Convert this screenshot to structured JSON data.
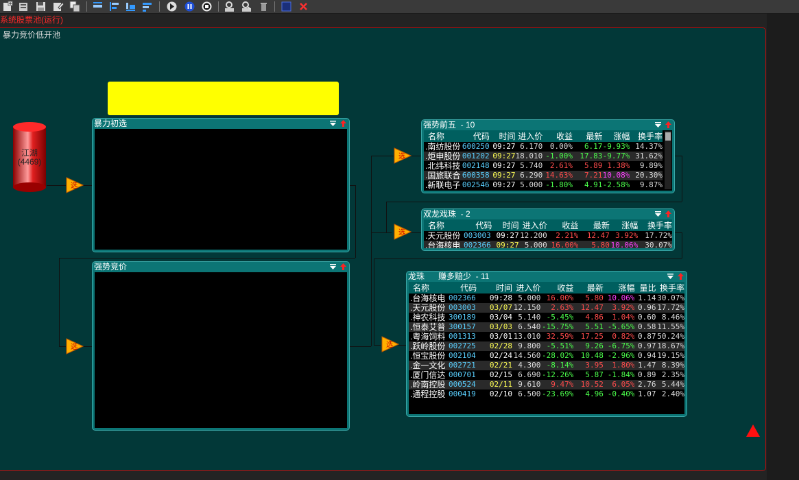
{
  "status_line": "系统股票池(运行)",
  "canvas_title": "暴力竞价低开池",
  "source": {
    "name": "江湖",
    "count": "(4469)"
  },
  "colors": {
    "up": "#ff4c4c",
    "down": "#4cff4c",
    "magenta": "#ff40ff",
    "code": "#5ad0ff"
  },
  "panels": {
    "violent": {
      "title": "暴力初选"
    },
    "strong": {
      "title": "强势竞价"
    },
    "top5": {
      "title": "强势前五  - 10",
      "headers": [
        "名称",
        "代码",
        "时间",
        "进入价",
        "收益",
        "最新",
        "涨幅",
        "换手率"
      ],
      "rows": [
        {
          "name": "南纺股份",
          "code": "600250",
          "time": "09:27",
          "price": "6.170",
          "gain": "0.00%",
          "gain_c": "w",
          "last": "6.17",
          "last_c": "g",
          "pct": "-9.93%",
          "pct_c": "g",
          "turn": "14.37%"
        },
        {
          "name": "炬申股份",
          "code": "001202",
          "time": "09:27",
          "price": "18.010",
          "gain": "-1.00%",
          "gain_c": "g",
          "last": "17.83",
          "last_c": "g",
          "pct": "-9.77%",
          "pct_c": "g",
          "turn": "31.62%"
        },
        {
          "name": "北纬科技",
          "code": "002148",
          "time": "09:27",
          "price": "5.740",
          "gain": "2.61%",
          "gain_c": "r",
          "last": "5.89",
          "last_c": "r",
          "pct": "1.38%",
          "pct_c": "r",
          "turn": "9.89%"
        },
        {
          "name": "国旅联合",
          "code": "600358",
          "time": "09:27",
          "price": "6.290",
          "gain": "14.63%",
          "gain_c": "r",
          "last": "7.21",
          "last_c": "r",
          "pct": "10.08%",
          "pct_c": "m",
          "turn": "20.30%"
        },
        {
          "name": "新联电子",
          "code": "002546",
          "time": "09:27",
          "price": "5.000",
          "gain": "-1.80%",
          "gain_c": "g",
          "last": "4.91",
          "last_c": "g",
          "pct": "-2.58%",
          "pct_c": "g",
          "turn": "9.87%"
        }
      ]
    },
    "dragon": {
      "title": "双龙戏珠  - 2",
      "headers": [
        "名称",
        "代码",
        "时间",
        "进入价",
        "收益",
        "最新",
        "涨幅",
        "换手率"
      ],
      "rows": [
        {
          "name": "天元股份",
          "code": "003003",
          "time": "09:27",
          "price": "12.200",
          "gain": "2.21%",
          "gain_c": "r",
          "last": "12.47",
          "last_c": "r",
          "pct": "3.92%",
          "pct_c": "r",
          "turn": "17.72%"
        },
        {
          "name": "台海核电",
          "code": "002366",
          "time": "09:27",
          "price": "5.000",
          "gain": "16.00%",
          "gain_c": "r",
          "last": "5.80",
          "last_c": "r",
          "pct": "10.06%",
          "pct_c": "m",
          "turn": "30.07%"
        }
      ]
    },
    "pearl": {
      "title": "龙珠      赚多赔少  - 11",
      "headers": [
        "名称",
        "代码",
        "时间",
        "进入价",
        "收益",
        "最新",
        "涨幅",
        "量比",
        "换手率"
      ],
      "rows": [
        {
          "name": "台海核电",
          "code": "002366",
          "time": "09:28",
          "price": "5.000",
          "gain": "16.00%",
          "gain_c": "r",
          "last": "5.80",
          "last_c": "r",
          "pct": "10.06%",
          "pct_c": "m",
          "vol": "1.14",
          "turn": "30.07%"
        },
        {
          "name": "天元股份",
          "code": "003003",
          "time": "03/07",
          "price": "12.150",
          "gain": "2.63%",
          "gain_c": "r",
          "last": "12.47",
          "last_c": "r",
          "pct": "3.92%",
          "pct_c": "r",
          "vol": "0.96",
          "turn": "17.72%"
        },
        {
          "name": "神农科技",
          "code": "300189",
          "time": "03/04",
          "price": "5.140",
          "gain": "-5.45%",
          "gain_c": "g",
          "last": "4.86",
          "last_c": "r",
          "pct": "1.04%",
          "pct_c": "r",
          "vol": "0.60",
          "turn": "8.46%"
        },
        {
          "name": "恒泰艾普",
          "code": "300157",
          "time": "03/03",
          "price": "6.540",
          "gain": "-15.75%",
          "gain_c": "g",
          "last": "5.51",
          "last_c": "g",
          "pct": "-5.65%",
          "pct_c": "g",
          "vol": "0.58",
          "turn": "11.55%"
        },
        {
          "name": "粤海饲料",
          "code": "001313",
          "time": "03/01",
          "price": "13.010",
          "gain": "32.59%",
          "gain_c": "r",
          "last": "17.25",
          "last_c": "r",
          "pct": "0.82%",
          "pct_c": "r",
          "vol": "0.87",
          "turn": "50.24%"
        },
        {
          "name": "跃岭股份",
          "code": "002725",
          "time": "02/28",
          "price": "9.800",
          "gain": "-5.51%",
          "gain_c": "g",
          "last": "9.26",
          "last_c": "g",
          "pct": "-6.75%",
          "pct_c": "g",
          "vol": "0.97",
          "turn": "18.67%"
        },
        {
          "name": "恒宝股份",
          "code": "002104",
          "time": "02/24",
          "price": "14.560",
          "gain": "-28.02%",
          "gain_c": "g",
          "last": "10.48",
          "last_c": "g",
          "pct": "-2.96%",
          "pct_c": "g",
          "vol": "0.94",
          "turn": "19.15%"
        },
        {
          "name": "金一文化",
          "code": "002721",
          "time": "02/21",
          "price": "4.300",
          "gain": "-8.14%",
          "gain_c": "g",
          "last": "3.95",
          "last_c": "r",
          "pct": "1.80%",
          "pct_c": "r",
          "vol": "1.47",
          "turn": "8.39%"
        },
        {
          "name": "厦门信达",
          "code": "000701",
          "time": "02/15",
          "price": "6.690",
          "gain": "-12.26%",
          "gain_c": "g",
          "last": "5.87",
          "last_c": "g",
          "pct": "-1.84%",
          "pct_c": "g",
          "vol": "0.89",
          "turn": "2.35%"
        },
        {
          "name": "岭南控股",
          "code": "000524",
          "time": "02/11",
          "price": "9.610",
          "gain": "9.47%",
          "gain_c": "r",
          "last": "10.52",
          "last_c": "r",
          "pct": "6.05%",
          "pct_c": "r",
          "vol": "2.76",
          "turn": "5.44%"
        },
        {
          "name": "通程控股",
          "code": "000419",
          "time": "02/10",
          "price": "6.500",
          "gain": "-23.69%",
          "gain_c": "g",
          "last": "4.96",
          "last_c": "g",
          "pct": "-0.40%",
          "pct_c": "g",
          "vol": "1.07",
          "turn": "2.40%"
        }
      ]
    }
  },
  "filter_node_glyph": "选"
}
